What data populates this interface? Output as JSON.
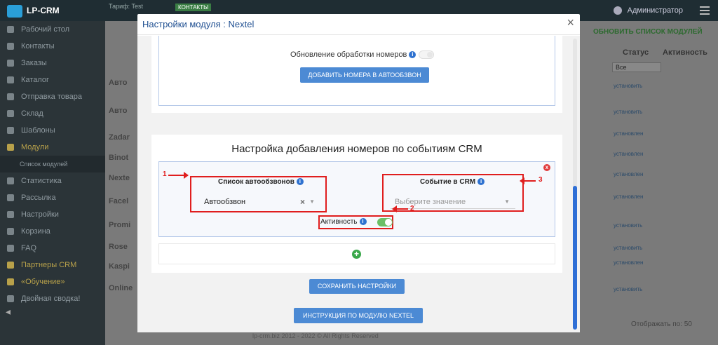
{
  "app": {
    "logo": "LP-CRM",
    "tariff": "Тариф: Test",
    "badge": "КОНТАКТЫ",
    "user": "Администратор"
  },
  "sidebar": {
    "items": [
      {
        "label": "Рабочий стол"
      },
      {
        "label": "Контакты"
      },
      {
        "label": "Заказы"
      },
      {
        "label": "Каталог"
      },
      {
        "label": "Отправка товара"
      },
      {
        "label": "Склад"
      },
      {
        "label": "Шаблоны"
      },
      {
        "label": "Модули"
      },
      {
        "label": "Список модулей"
      },
      {
        "label": "Статистика"
      },
      {
        "label": "Рассылка"
      },
      {
        "label": "Настройки"
      },
      {
        "label": "Корзина"
      },
      {
        "label": "FAQ"
      },
      {
        "label": "Партнеры CRM"
      },
      {
        "label": "«Обучение»"
      },
      {
        "label": "Двойная сводка!"
      }
    ]
  },
  "background": {
    "refresh_label": "ОБНОВИТЬ СПИСОК МОДУЛЕЙ",
    "col_status": "Статус",
    "col_active": "Активность",
    "filter_value": "Все",
    "rows": [
      {
        "name": "Авто",
        "status": "установить"
      },
      {
        "name": "Авто",
        "status": "установить"
      },
      {
        "name": "Zadar",
        "status": "установлен"
      },
      {
        "name": "Binot",
        "status": "установлен"
      },
      {
        "name": "Nexte",
        "status": "установлен"
      },
      {
        "name": "Facel",
        "status": "установлен"
      },
      {
        "name": "Promi",
        "status": "установить"
      },
      {
        "name": "Rose",
        "status": "установить"
      },
      {
        "name": "Kaspi",
        "status": "установлен"
      },
      {
        "name": "Online",
        "status": "установить"
      }
    ],
    "footer": "lp-crm.biz 2012 - 2022 © All Rights Reserved",
    "per_page_label": "Отображать по:",
    "per_page_value": "50"
  },
  "modal": {
    "title": "Настройки модуля : Nextel",
    "close": "×",
    "update_label": "Обновление обработки номеров",
    "add_numbers_button": "ДОБАВИТЬ НОМЕРА В АВТООБЗВОН",
    "events_title": "Настройка добавления номеров по событиям CRM",
    "list_label": "Список автообзвонов",
    "list_value": "Автообзвон",
    "event_label": "Событие в CRM",
    "event_placeholder": "Выберите значение",
    "active_label": "Активность",
    "save_button": "СОХРАНИТЬ НАСТРОЙКИ",
    "manual_button": "ИНСТРУКЦИЯ ПО МОДУЛЮ NEXTEL"
  },
  "annotations": {
    "one": "1",
    "two": "2",
    "three": "3"
  },
  "icons": {
    "info": "i",
    "remove": "x",
    "add": "+",
    "clear": "×",
    "caret": "▼"
  },
  "colors": {
    "accent_blue": "#4c8ad4",
    "title_blue": "#1f4f91",
    "annotation_red": "#e01e1e",
    "toggle_green": "#6cbf66"
  }
}
